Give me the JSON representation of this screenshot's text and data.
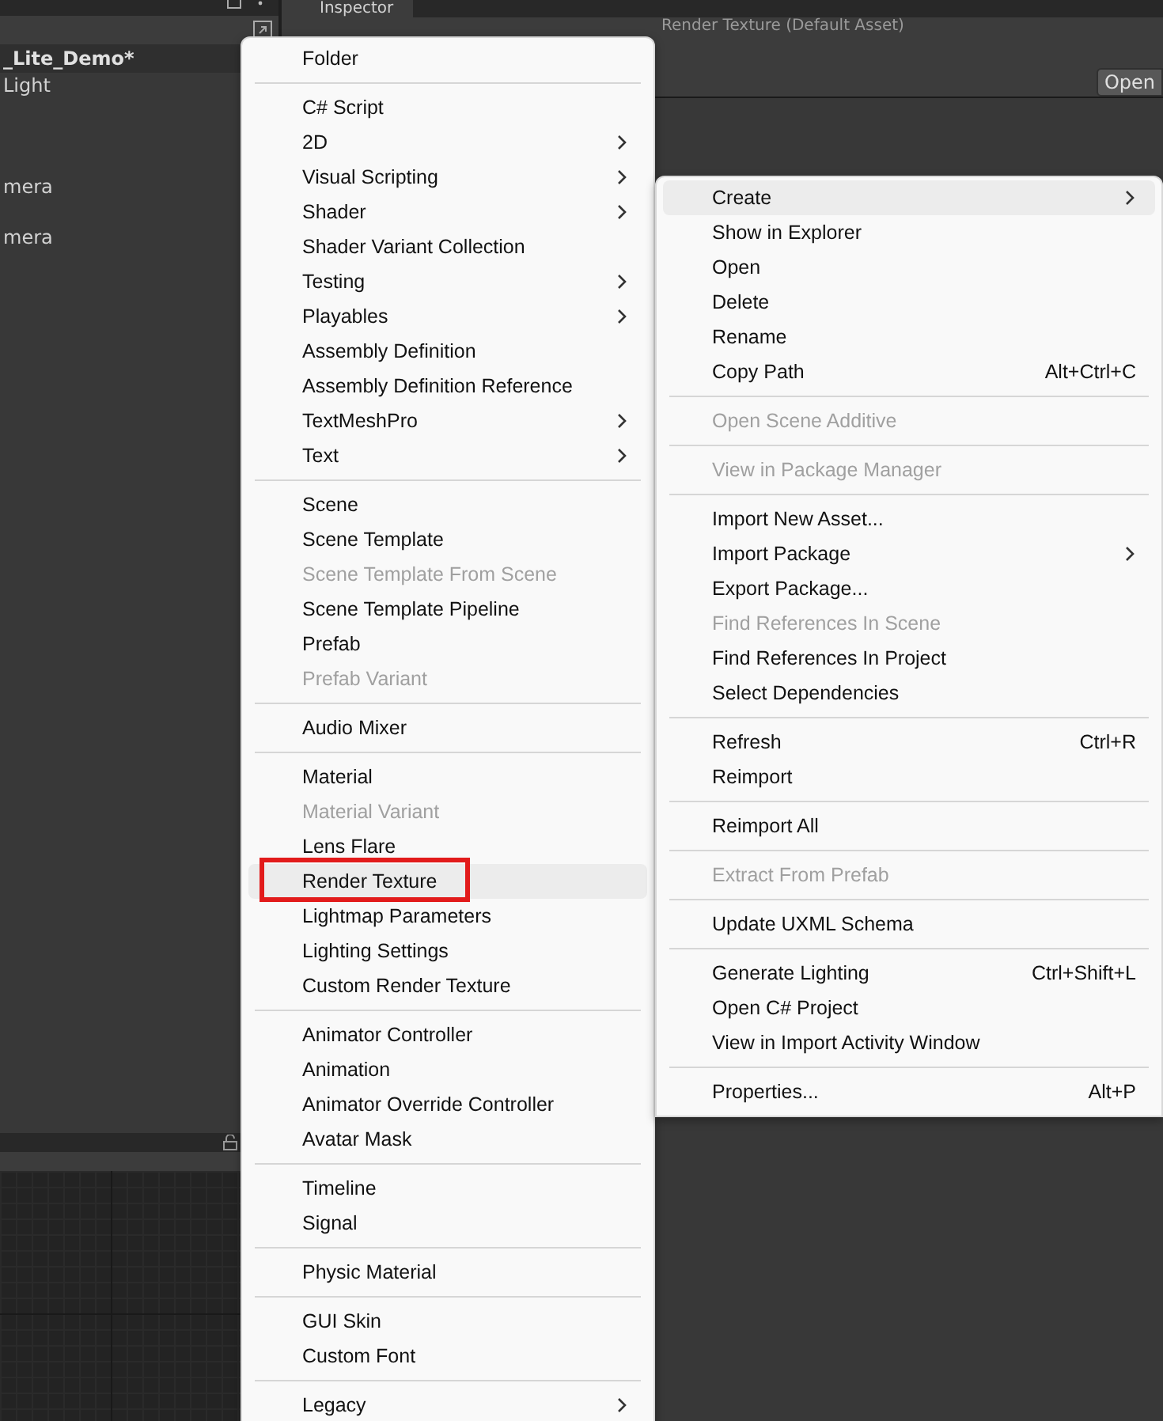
{
  "hierarchy": {
    "scene": "_Lite_Demo*",
    "items": [
      "Light",
      "mera",
      "mera"
    ]
  },
  "inspector": {
    "tab": "Inspector",
    "title": "Render Texture (Default Asset)",
    "open_button": "Open"
  },
  "create_menu": {
    "sections": [
      [
        {
          "label": "Folder",
          "submenu": false,
          "disabled": false,
          "highlighted": false,
          "outlined": false
        }
      ],
      [
        {
          "label": "C# Script",
          "submenu": false,
          "disabled": false,
          "highlighted": false,
          "outlined": false
        },
        {
          "label": "2D",
          "submenu": true,
          "disabled": false,
          "highlighted": false,
          "outlined": false
        },
        {
          "label": "Visual Scripting",
          "submenu": true,
          "disabled": false,
          "highlighted": false,
          "outlined": false
        },
        {
          "label": "Shader",
          "submenu": true,
          "disabled": false,
          "highlighted": false,
          "outlined": false
        },
        {
          "label": "Shader Variant Collection",
          "submenu": false,
          "disabled": false,
          "highlighted": false,
          "outlined": false
        },
        {
          "label": "Testing",
          "submenu": true,
          "disabled": false,
          "highlighted": false,
          "outlined": false
        },
        {
          "label": "Playables",
          "submenu": true,
          "disabled": false,
          "highlighted": false,
          "outlined": false
        },
        {
          "label": "Assembly Definition",
          "submenu": false,
          "disabled": false,
          "highlighted": false,
          "outlined": false
        },
        {
          "label": "Assembly Definition Reference",
          "submenu": false,
          "disabled": false,
          "highlighted": false,
          "outlined": false
        },
        {
          "label": "TextMeshPro",
          "submenu": true,
          "disabled": false,
          "highlighted": false,
          "outlined": false
        },
        {
          "label": "Text",
          "submenu": true,
          "disabled": false,
          "highlighted": false,
          "outlined": false
        }
      ],
      [
        {
          "label": "Scene",
          "submenu": false,
          "disabled": false,
          "highlighted": false,
          "outlined": false
        },
        {
          "label": "Scene Template",
          "submenu": false,
          "disabled": false,
          "highlighted": false,
          "outlined": false
        },
        {
          "label": "Scene Template From Scene",
          "submenu": false,
          "disabled": true,
          "highlighted": false,
          "outlined": false
        },
        {
          "label": "Scene Template Pipeline",
          "submenu": false,
          "disabled": false,
          "highlighted": false,
          "outlined": false
        },
        {
          "label": "Prefab",
          "submenu": false,
          "disabled": false,
          "highlighted": false,
          "outlined": false
        },
        {
          "label": "Prefab Variant",
          "submenu": false,
          "disabled": true,
          "highlighted": false,
          "outlined": false
        }
      ],
      [
        {
          "label": "Audio Mixer",
          "submenu": false,
          "disabled": false,
          "highlighted": false,
          "outlined": false
        }
      ],
      [
        {
          "label": "Material",
          "submenu": false,
          "disabled": false,
          "highlighted": false,
          "outlined": false
        },
        {
          "label": "Material Variant",
          "submenu": false,
          "disabled": true,
          "highlighted": false,
          "outlined": false
        },
        {
          "label": "Lens Flare",
          "submenu": false,
          "disabled": false,
          "highlighted": false,
          "outlined": false
        },
        {
          "label": "Render Texture",
          "submenu": false,
          "disabled": false,
          "highlighted": true,
          "outlined": true
        },
        {
          "label": "Lightmap Parameters",
          "submenu": false,
          "disabled": false,
          "highlighted": false,
          "outlined": false
        },
        {
          "label": "Lighting Settings",
          "submenu": false,
          "disabled": false,
          "highlighted": false,
          "outlined": false
        },
        {
          "label": "Custom Render Texture",
          "submenu": false,
          "disabled": false,
          "highlighted": false,
          "outlined": false
        }
      ],
      [
        {
          "label": "Animator Controller",
          "submenu": false,
          "disabled": false,
          "highlighted": false,
          "outlined": false
        },
        {
          "label": "Animation",
          "submenu": false,
          "disabled": false,
          "highlighted": false,
          "outlined": false
        },
        {
          "label": "Animator Override Controller",
          "submenu": false,
          "disabled": false,
          "highlighted": false,
          "outlined": false
        },
        {
          "label": "Avatar Mask",
          "submenu": false,
          "disabled": false,
          "highlighted": false,
          "outlined": false
        }
      ],
      [
        {
          "label": "Timeline",
          "submenu": false,
          "disabled": false,
          "highlighted": false,
          "outlined": false
        },
        {
          "label": "Signal",
          "submenu": false,
          "disabled": false,
          "highlighted": false,
          "outlined": false
        }
      ],
      [
        {
          "label": "Physic Material",
          "submenu": false,
          "disabled": false,
          "highlighted": false,
          "outlined": false
        }
      ],
      [
        {
          "label": "GUI Skin",
          "submenu": false,
          "disabled": false,
          "highlighted": false,
          "outlined": false
        },
        {
          "label": "Custom Font",
          "submenu": false,
          "disabled": false,
          "highlighted": false,
          "outlined": false
        }
      ],
      [
        {
          "label": "Legacy",
          "submenu": true,
          "disabled": false,
          "highlighted": false,
          "outlined": false
        }
      ]
    ]
  },
  "context_menu": {
    "sections": [
      [
        {
          "label": "Create",
          "submenu": true,
          "disabled": false,
          "highlighted": true
        },
        {
          "label": "Show in Explorer",
          "submenu": false,
          "disabled": false,
          "highlighted": false
        },
        {
          "label": "Open",
          "submenu": false,
          "disabled": false,
          "highlighted": false
        },
        {
          "label": "Delete",
          "submenu": false,
          "disabled": false,
          "highlighted": false
        },
        {
          "label": "Rename",
          "submenu": false,
          "disabled": false,
          "highlighted": false
        },
        {
          "label": "Copy Path",
          "shortcut": "Alt+Ctrl+C",
          "submenu": false,
          "disabled": false,
          "highlighted": false
        }
      ],
      [
        {
          "label": "Open Scene Additive",
          "submenu": false,
          "disabled": true,
          "highlighted": false
        }
      ],
      [
        {
          "label": "View in Package Manager",
          "submenu": false,
          "disabled": true,
          "highlighted": false
        }
      ],
      [
        {
          "label": "Import New Asset...",
          "submenu": false,
          "disabled": false,
          "highlighted": false
        },
        {
          "label": "Import Package",
          "submenu": true,
          "disabled": false,
          "highlighted": false
        },
        {
          "label": "Export Package...",
          "submenu": false,
          "disabled": false,
          "highlighted": false
        },
        {
          "label": "Find References In Scene",
          "submenu": false,
          "disabled": true,
          "highlighted": false
        },
        {
          "label": "Find References In Project",
          "submenu": false,
          "disabled": false,
          "highlighted": false
        },
        {
          "label": "Select Dependencies",
          "submenu": false,
          "disabled": false,
          "highlighted": false
        }
      ],
      [
        {
          "label": "Refresh",
          "shortcut": "Ctrl+R",
          "submenu": false,
          "disabled": false,
          "highlighted": false
        },
        {
          "label": "Reimport",
          "submenu": false,
          "disabled": false,
          "highlighted": false
        }
      ],
      [
        {
          "label": "Reimport All",
          "submenu": false,
          "disabled": false,
          "highlighted": false
        }
      ],
      [
        {
          "label": "Extract From Prefab",
          "submenu": false,
          "disabled": true,
          "highlighted": false
        }
      ],
      [
        {
          "label": "Update UXML Schema",
          "submenu": false,
          "disabled": false,
          "highlighted": false
        }
      ],
      [
        {
          "label": "Generate Lighting",
          "shortcut": "Ctrl+Shift+L",
          "submenu": false,
          "disabled": false,
          "highlighted": false
        },
        {
          "label": "Open C# Project",
          "submenu": false,
          "disabled": false,
          "highlighted": false
        },
        {
          "label": "View in Import Activity Window",
          "submenu": false,
          "disabled": false,
          "highlighted": false
        }
      ],
      [
        {
          "label": "Properties...",
          "shortcut": "Alt+P",
          "submenu": false,
          "disabled": false,
          "highlighted": false
        }
      ]
    ]
  }
}
